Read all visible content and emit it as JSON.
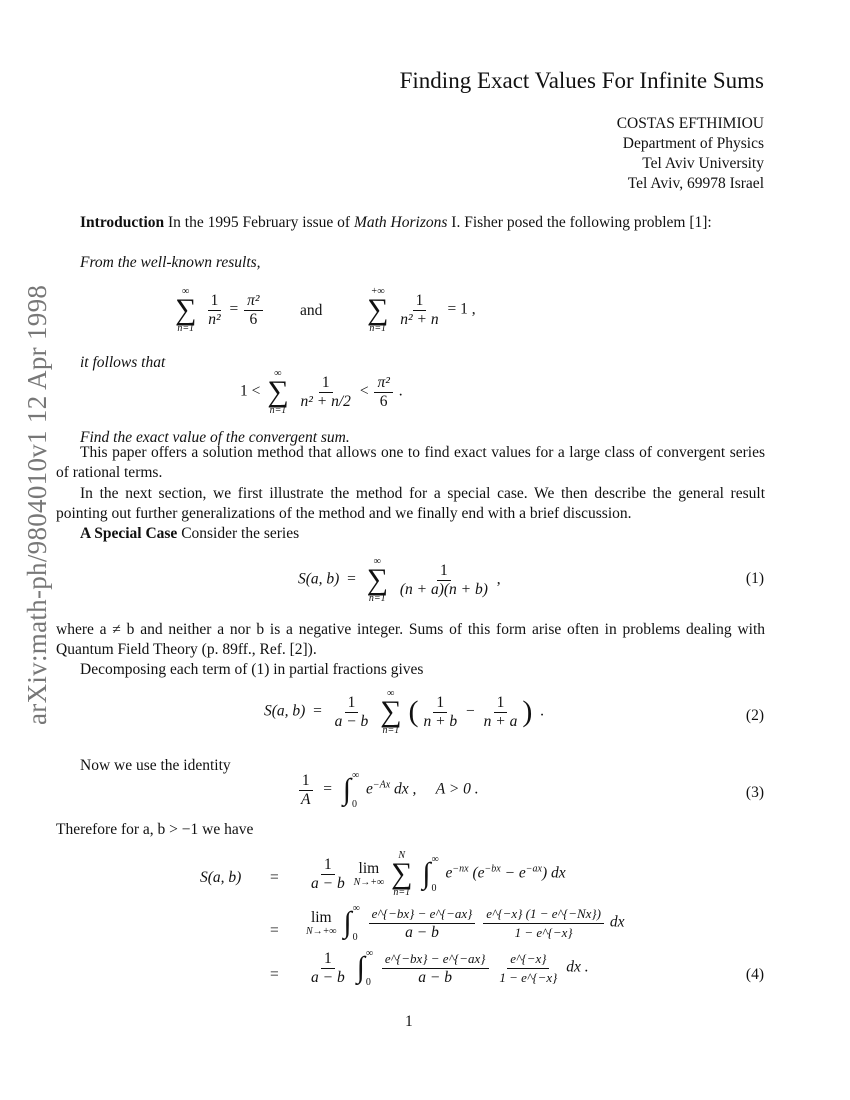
{
  "sidebar": {
    "text": "arXiv:math-ph/9804010v1  12 Apr 1998"
  },
  "header": {
    "title": "Finding Exact Values For Infinite Sums",
    "author": "COSTAS EFTHIMIOU",
    "affiliation": [
      "Department of Physics",
      "Tel Aviv University",
      "Tel Aviv, 69978 Israel"
    ]
  },
  "intro": {
    "heading": "Introduction",
    "text_before_journal": " In the 1995 February issue of ",
    "journal": "Math Horizons",
    "text_after_journal": " I. Fisher posed the following problem [1]:",
    "quote_line1": "From the well-known results,",
    "eq_a": {
      "lhs": "1",
      "lhs_den": "n²",
      "eq": "=",
      "rhs_num": "π²",
      "rhs_den": "6",
      "sum_top": "∞",
      "sum_bottom": "n=1"
    },
    "and": "and",
    "eq_b": {
      "num": "1",
      "den": "n² + n",
      "rhs": "= 1 ,",
      "sum_top": "+∞",
      "sum_bottom": "n=1"
    },
    "follows": "it follows that",
    "ineq": {
      "left": "1 <",
      "num": "1",
      "den": "n² + n/2",
      "mid": "<",
      "rhs_num": "π²",
      "rhs_den": "6",
      "end": ".",
      "sum_top": "∞",
      "sum_bottom": "n=1"
    },
    "find": "Find the exact value of the convergent sum.",
    "p1": "This paper offers a solution method that allows one to find exact values for a large class of convergent series of rational terms.",
    "p2": "In the next section, we first illustrate the method for a special case. We then describe the general result pointing out further generalizations of the method and we finally end with a brief discussion."
  },
  "special": {
    "heading": "A Special Case",
    "intro": " Consider the series",
    "eq1": {
      "lhs": "S(a, b)",
      "eq": "=",
      "num": "1",
      "den": "(n + a)(n + b)",
      "end": ",",
      "sum_top": "∞",
      "sum_bottom": "n=1",
      "number": "(1)"
    },
    "where": "where a ≠ b and neither a nor b is a negative integer.  Sums of this form arise often in problems dealing with Quantum Field Theory (p. 89ff., Ref. [2]).",
    "decomp": "Decomposing each term of (1) in partial fractions gives",
    "eq2": {
      "lhs": "S(a, b)",
      "eq": "=",
      "pre_num": "1",
      "pre_den": "a − b",
      "t1_num": "1",
      "t1_den": "n + b",
      "minus": "−",
      "t2_num": "1",
      "t2_den": "n + a",
      "end": ".",
      "sum_top": "∞",
      "sum_bottom": "n=1",
      "number": "(2)"
    },
    "identity": "Now we use the identity",
    "eq3": {
      "lhs_num": "1",
      "lhs_den": "A",
      "eq": "=",
      "int_top": "∞",
      "int_bottom": "0",
      "integrand": "e",
      "exp": "−Ax",
      "dx": " dx ,",
      "cond": "A > 0 .",
      "number": "(3)"
    },
    "therefore": "Therefore for a, b > −1 we have",
    "eq4": {
      "lhs": "S(a, b)",
      "eq": "=",
      "line1": {
        "pre_num": "1",
        "pre_den": "a − b",
        "lim": "lim",
        "lim_sub": "N→+∞",
        "sum_top": "N",
        "sum_bottom": "n=1",
        "int_top": "∞",
        "int_bottom": "0",
        "body": "e",
        "exp1": "−nx",
        "paren": "(e",
        "exp2": "−bx",
        "mid": " − e",
        "exp3": "−ax",
        "close": ") dx"
      },
      "line2": {
        "lim": "lim",
        "lim_sub": "N→+∞",
        "int_top": "∞",
        "int_bottom": "0",
        "f1_num": "e^{−bx} − e^{−ax}",
        "f1_den": "a − b",
        "f2_num": "e^{−x} (1 − e^{−Nx})",
        "f2_den": "1 − e^{−x}",
        "dx": "dx"
      },
      "line3": {
        "pre_num": "1",
        "pre_den": "a − b",
        "int_top": "∞",
        "int_bottom": "0",
        "f1_num": "e^{−bx} − e^{−ax}",
        "f1_den": "a − b",
        "f2_num": "e^{−x}",
        "f2_den": "1 − e^{−x}",
        "dx": "dx ."
      },
      "number": "(4)"
    }
  },
  "page_number": "1"
}
